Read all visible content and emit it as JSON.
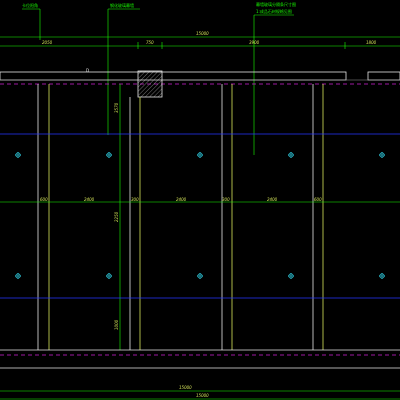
{
  "colors": {
    "background": "#000000",
    "white": "#e6e6e6",
    "green": "#18ff00",
    "yellow": "#d8e85a",
    "blue": "#2436ff",
    "magenta": "#d11fd6",
    "cyan": "#36e9ff"
  },
  "annotations": {
    "top_left": "卡位阳角",
    "top_mid": "钢化玻璃幕墙",
    "top_right_1": "幕墙玻璃分隔条尺寸图",
    "top_right_2": "1:成品石材规格见图"
  },
  "top_dims": {
    "overall": "15000",
    "segments": [
      "2050",
      "750",
      "3900",
      "1800"
    ]
  },
  "row_dims": {
    "upper": [
      "600",
      "2400",
      "300",
      "2400",
      "300",
      "2400",
      "600"
    ]
  },
  "vertical_dims": {
    "top": "3570",
    "mid": "2250",
    "bottom": "1000"
  },
  "bottom_dims": {
    "outer": "15000",
    "inner": "15000"
  }
}
